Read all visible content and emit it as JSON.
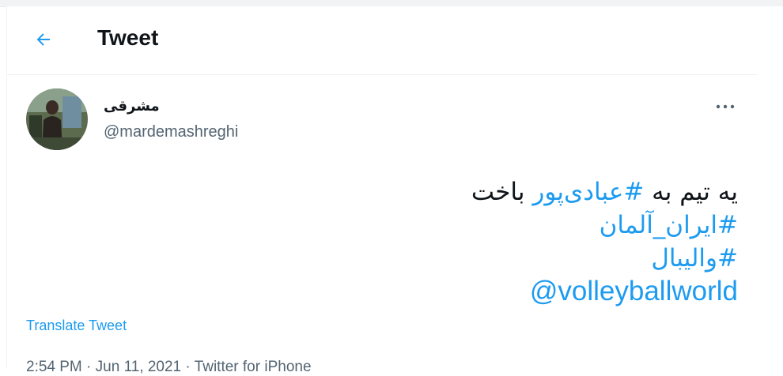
{
  "header": {
    "title": "Tweet",
    "back_icon": "arrow-left-icon"
  },
  "tweet": {
    "author": {
      "display_name": "مشرقی",
      "handle": "@mardemashreghi",
      "avatar_icon": "avatar-photo"
    },
    "more_icon": "more-horizontal-icon",
    "body": {
      "line1_before": "یه تیم به",
      "line1_hashtag": "#عبادی‌پور",
      "line1_after": "باخت",
      "line2_hashtag": "#ایران_آلمان",
      "line3_hashtag": "#والیبال",
      "line4_mention": "@volleyballworld"
    },
    "translate_label": "Translate Tweet",
    "meta": {
      "time": "2:54 PM",
      "separator": "·",
      "date": "Jun 11, 2021",
      "source": "Twitter for iPhone"
    }
  },
  "colors": {
    "accent": "#1d9bf0",
    "secondary_text": "#536471",
    "text": "#0f1419"
  }
}
